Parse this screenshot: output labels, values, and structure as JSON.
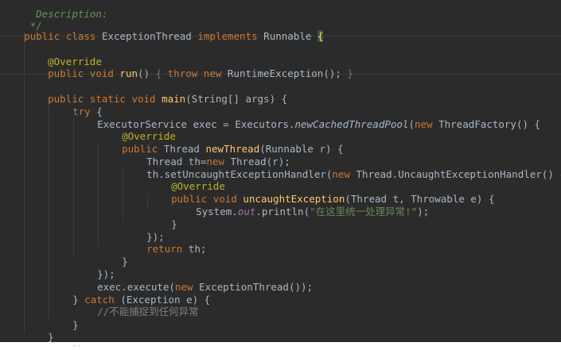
{
  "editor": {
    "language": "java",
    "theme_colors": {
      "background": "#2b2b2b",
      "keyword": "#cc7832",
      "annotation": "#bbb529",
      "method_declaration": "#ffc66d",
      "string": "#6a8759",
      "comment": "#808080",
      "doc_comment": "#629755",
      "static_field": "#9876aa",
      "default_text": "#a9b7c6"
    },
    "lines": {
      "l0": "  Description:",
      "l1": " */",
      "l2a": "public class ",
      "l2b": "ExceptionThread ",
      "l2c": "implements ",
      "l2d": "Runnable ",
      "l2e": "{",
      "l3a": "@Override",
      "l4a": "public void ",
      "l4b": "run",
      "l4c": "() ",
      "l4d": "{ ",
      "l4e": "throw new ",
      "l4f": "RuntimeException(); ",
      "l4g": "}",
      "l5a": "public static void ",
      "l5b": "main",
      "l5c": "(String[] args) {",
      "l6a": "try ",
      "l6b": "{",
      "l7a": "ExecutorService exec = Executors.",
      "l7b": "newCachedThreadPool",
      "l7c": "(",
      "l7d": "new ",
      "l7e": "ThreadFactory() {",
      "l8a": "@Override",
      "l9a": "public ",
      "l9b": "Thread ",
      "l9c": "newThread",
      "l9d": "(Runnable r) {",
      "l10a": "Thread th=",
      "l10b": "new ",
      "l10c": "Thread(r);",
      "l11a": "th.setUncaughtExceptionHandler(",
      "l11b": "new ",
      "l11c": "Thread.UncaughtExceptionHandler() {",
      "l12a": "@Override",
      "l13a": "public void ",
      "l13b": "uncaughtException",
      "l13c": "(Thread t, Throwable e) {",
      "l14a": "System.",
      "l14b": "out",
      "l14c": ".println(",
      "l14d": "\"在这里统一处理异常!\"",
      "l14e": ");",
      "l15a": "}",
      "l16a": "});",
      "l17a": "return ",
      "l17b": "th;",
      "l18a": "}",
      "l19a": "});",
      "l20a": "exec.execute(",
      "l20b": "new ",
      "l20c": "ExceptionThread());",
      "l21a": "} ",
      "l21b": "catch ",
      "l21c": "(Exception e) {",
      "l22a": "//不能捕捉到任何异常",
      "l23a": "}",
      "l24a": "}",
      "l25a": "}"
    }
  },
  "cut_marks": "- -"
}
